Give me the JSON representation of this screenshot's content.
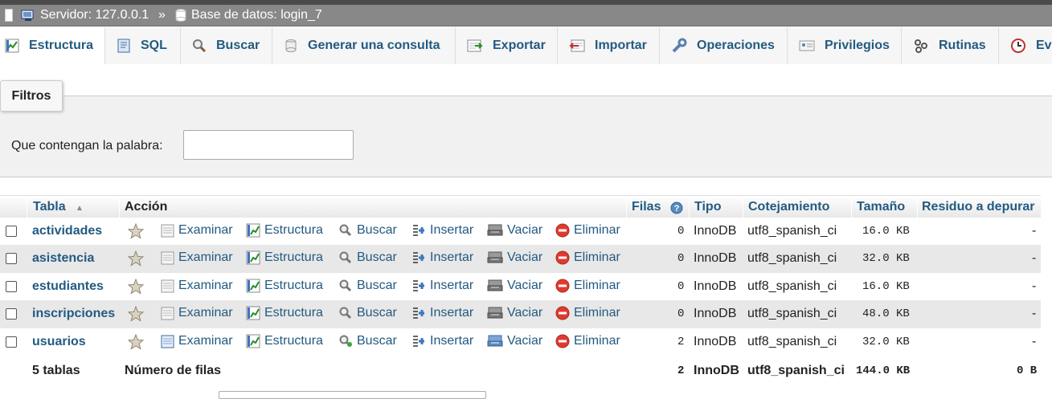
{
  "breadcrumb": {
    "server": "Servidor: 127.0.0.1",
    "separator": "»",
    "database": "Base de datos: login_7"
  },
  "tabs": [
    {
      "label": "Estructura",
      "icon": "structure-icon",
      "active": true
    },
    {
      "label": "SQL",
      "icon": "sql-icon"
    },
    {
      "label": "Buscar",
      "icon": "search-icon"
    },
    {
      "label": "Generar una consulta",
      "icon": "query-icon"
    },
    {
      "label": "Exportar",
      "icon": "export-icon"
    },
    {
      "label": "Importar",
      "icon": "import-icon"
    },
    {
      "label": "Operaciones",
      "icon": "wrench-icon"
    },
    {
      "label": "Privilegios",
      "icon": "privileges-icon"
    },
    {
      "label": "Rutinas",
      "icon": "routines-icon"
    },
    {
      "label": "Ev",
      "icon": "events-icon"
    }
  ],
  "filters": {
    "button": "Filtros",
    "label": "Que contengan la palabra:",
    "value": ""
  },
  "table": {
    "headers": {
      "tabla": "Tabla",
      "sort": "▲",
      "accion": "Acción",
      "filas": "Filas",
      "tipo": "Tipo",
      "cotejamiento": "Cotejamiento",
      "tamano": "Tamaño",
      "residuo": "Residuo a depurar"
    },
    "actions": [
      "Examinar",
      "Estructura",
      "Buscar",
      "Insertar",
      "Vaciar",
      "Eliminar"
    ],
    "rows": [
      {
        "name": "actividades",
        "rows": "0",
        "type": "InnoDB",
        "collation": "utf8_spanish_ci",
        "size": "16.0 KB",
        "overhead": "-"
      },
      {
        "name": "asistencia",
        "rows": "0",
        "type": "InnoDB",
        "collation": "utf8_spanish_ci",
        "size": "32.0 KB",
        "overhead": "-"
      },
      {
        "name": "estudiantes",
        "rows": "0",
        "type": "InnoDB",
        "collation": "utf8_spanish_ci",
        "size": "16.0 KB",
        "overhead": "-"
      },
      {
        "name": "inscripciones",
        "rows": "0",
        "type": "InnoDB",
        "collation": "utf8_spanish_ci",
        "size": "48.0 KB",
        "overhead": "-"
      },
      {
        "name": "usuarios",
        "rows": "2",
        "type": "InnoDB",
        "collation": "utf8_spanish_ci",
        "size": "32.0 KB",
        "overhead": "-"
      }
    ],
    "footer": {
      "count": "5 tablas",
      "label": "Número de filas",
      "rows": "2",
      "type": "InnoDB",
      "collation": "utf8_spanish_ci",
      "size": "144.0 KB",
      "overhead": "0 B"
    }
  },
  "colors": {
    "link": "#235a81",
    "header_bar": "#888888",
    "stripe": "#e8e8e8"
  }
}
